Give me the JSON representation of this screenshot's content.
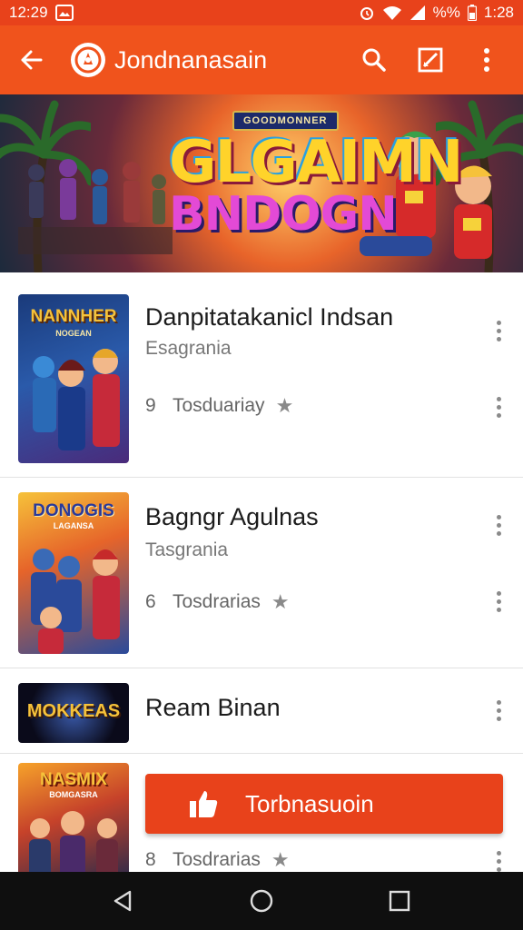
{
  "status_bar": {
    "time_left": "12:29",
    "battery_text": "%%",
    "time_right": "1:28"
  },
  "app_bar": {
    "title": "Jondnanasain",
    "icons": [
      "back-arrow-icon",
      "app-logo-icon",
      "search-icon",
      "edit-icon",
      "more-vertical-icon"
    ]
  },
  "banner": {
    "badge": "GOODMONNER",
    "title_line1": "GLGAIMN",
    "title_line2": "BNDOGN"
  },
  "games": [
    {
      "title": "Danpitatakanicl Indsan",
      "subtitle": "Esagrania",
      "rating_num": "9",
      "rating_label": "Tosduariay",
      "cover_title": "NANNHER",
      "cover_subtitle": "NOGEAN"
    },
    {
      "title": "Bagngr Agulnas",
      "subtitle": "Tasgrania",
      "rating_num": "6",
      "rating_label": "Tosdrarias",
      "cover_title": "DONOGIS",
      "cover_subtitle": "LAGANSA"
    },
    {
      "title": "Ream Binan",
      "cover_title": "MOKKEAS"
    },
    {
      "rating_num": "8",
      "rating_label": "Tosdrarias",
      "cover_title": "NASMIX",
      "cover_subtitle": "BOMGASRA"
    }
  ],
  "cta": {
    "label": "Torbnasuoin",
    "icon": "thumbs-up-icon"
  },
  "colors": {
    "accent": "#f0531c",
    "status": "#e8421b"
  },
  "nav_bar": {
    "icons": [
      "nav-back-icon",
      "nav-home-icon",
      "nav-recents-icon"
    ]
  }
}
